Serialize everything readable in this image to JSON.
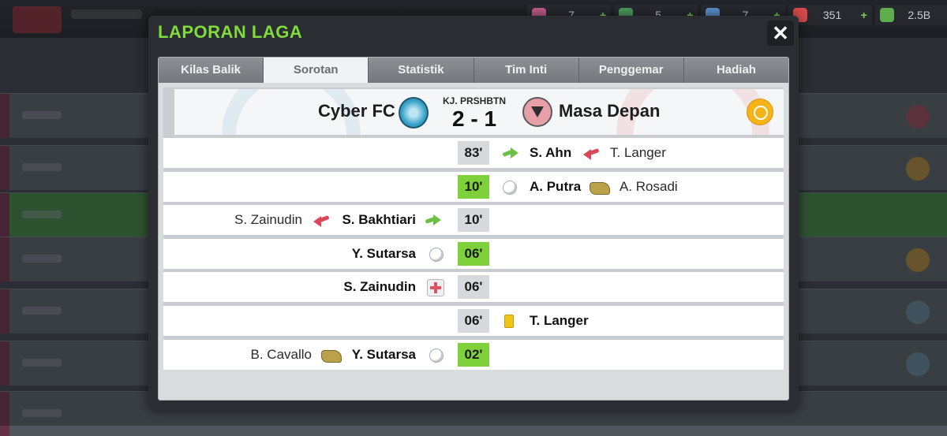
{
  "app": {
    "resources": [
      {
        "name": "resource-1",
        "value": "7",
        "icon": "token-icon",
        "color": "#c05a8a"
      },
      {
        "name": "resource-2",
        "value": "5",
        "icon": "whistle-icon",
        "color": "#4c9a5c"
      },
      {
        "name": "resource-3",
        "value": "7",
        "icon": "boost-icon",
        "color": "#5a8fc8"
      },
      {
        "name": "resource-4",
        "value": "351",
        "icon": "medkit-icon",
        "color": "#d64a4a"
      },
      {
        "name": "resource-5",
        "value": "2.5B",
        "icon": "cash-icon",
        "color": "#5fae4e"
      }
    ],
    "plus_label": "+"
  },
  "modal": {
    "title": "LAPORAN LAGA",
    "close_label": "✕",
    "tabs": [
      {
        "label": "Kilas Balik",
        "active": false
      },
      {
        "label": "Sorotan",
        "active": true
      },
      {
        "label": "Statistik",
        "active": false
      },
      {
        "label": "Tim Inti",
        "active": false
      },
      {
        "label": "Penggemar",
        "active": false
      },
      {
        "label": "Hadiah",
        "active": false
      }
    ],
    "match": {
      "home_team": "Cyber FC",
      "away_team": "Masa Depan",
      "score_label": "KJ. PRSHBTN",
      "score": "2 - 1",
      "weather_icon": "sun-icon"
    },
    "events": [
      {
        "minute": "83'",
        "goal": false,
        "side": "away",
        "type": "substitution",
        "primary": "S. Ahn",
        "secondary": "T. Langer"
      },
      {
        "minute": "10'",
        "goal": true,
        "side": "away",
        "type": "goal",
        "primary": "A. Putra",
        "secondary": "A. Rosadi"
      },
      {
        "minute": "10'",
        "goal": false,
        "side": "home",
        "type": "substitution",
        "primary": "S. Bakhtiari",
        "secondary": "S. Zainudin"
      },
      {
        "minute": "06'",
        "goal": true,
        "side": "home",
        "type": "goal",
        "primary": "Y. Sutarsa",
        "secondary": ""
      },
      {
        "minute": "06'",
        "goal": false,
        "side": "home",
        "type": "injury",
        "primary": "S. Zainudin",
        "secondary": ""
      },
      {
        "minute": "06'",
        "goal": false,
        "side": "away",
        "type": "yellow-card",
        "primary": "T. Langer",
        "secondary": ""
      },
      {
        "minute": "02'",
        "goal": true,
        "side": "home",
        "type": "goal",
        "primary": "Y. Sutarsa",
        "secondary": "B. Cavallo"
      }
    ]
  }
}
